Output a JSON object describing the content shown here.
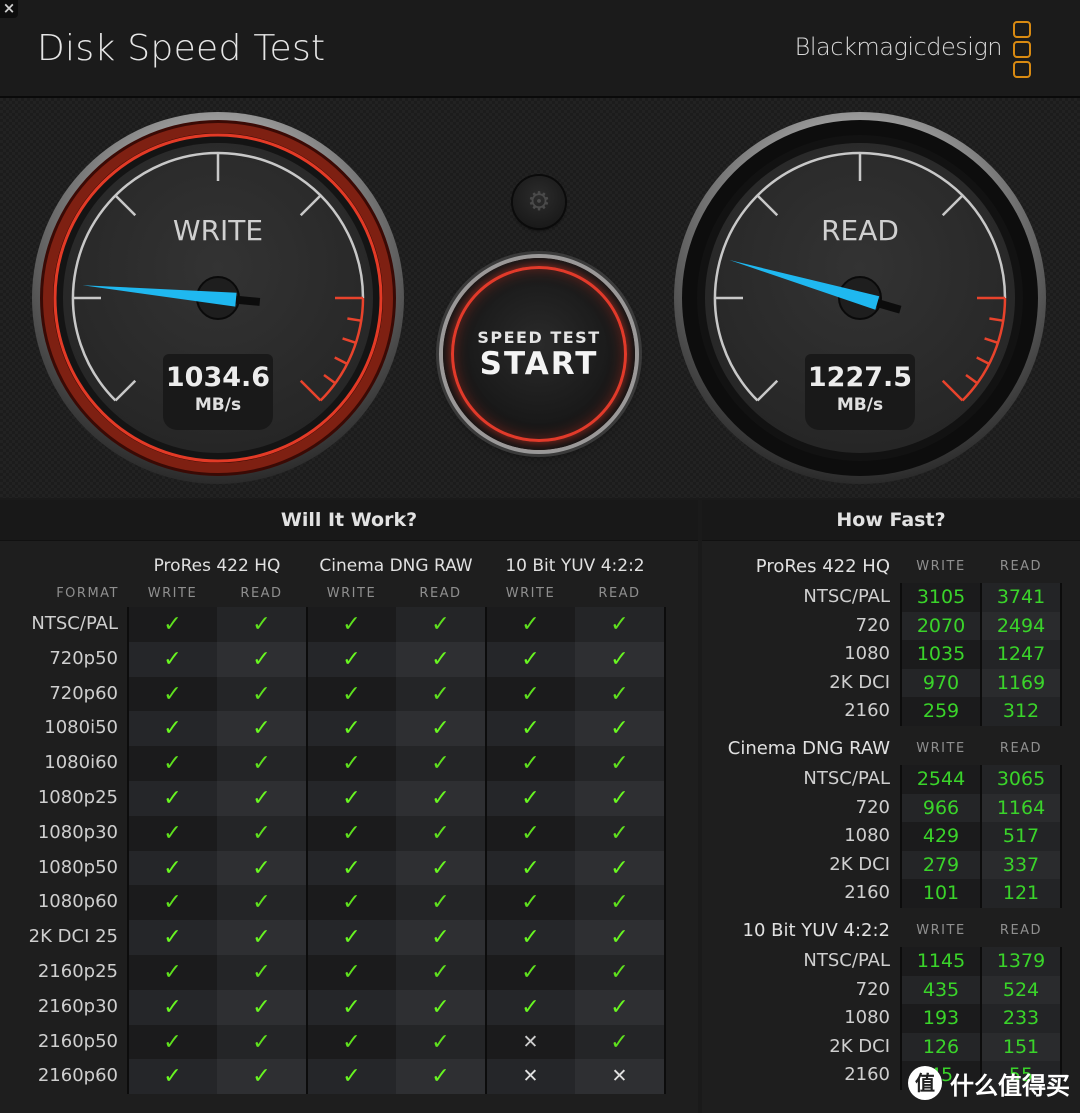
{
  "window": {
    "close_icon": "×",
    "title": "Disk Speed Test",
    "brand": "Blackmagicdesign"
  },
  "gauges": {
    "write": {
      "label": "WRITE",
      "value": "1034.6",
      "unit": "MB/s",
      "needle_fraction": 0.02
    },
    "read": {
      "label": "READ",
      "value": "1227.5",
      "unit": "MB/s",
      "needle_fraction": 0.06
    }
  },
  "controls": {
    "settings_icon": "⚙",
    "start_small": "SPEED TEST",
    "start_big": "START"
  },
  "will_it_work": {
    "title": "Will It Work?",
    "format_header": "FORMAT",
    "codecs": [
      "ProRes 422 HQ",
      "Cinema DNG RAW",
      "10 Bit YUV 4:2:2"
    ],
    "subheaders": [
      "WRITE",
      "READ",
      "WRITE",
      "READ",
      "WRITE",
      "READ"
    ],
    "rows": [
      {
        "format": "NTSC/PAL",
        "cells": [
          true,
          true,
          true,
          true,
          true,
          true
        ]
      },
      {
        "format": "720p50",
        "cells": [
          true,
          true,
          true,
          true,
          true,
          true
        ]
      },
      {
        "format": "720p60",
        "cells": [
          true,
          true,
          true,
          true,
          true,
          true
        ]
      },
      {
        "format": "1080i50",
        "cells": [
          true,
          true,
          true,
          true,
          true,
          true
        ]
      },
      {
        "format": "1080i60",
        "cells": [
          true,
          true,
          true,
          true,
          true,
          true
        ]
      },
      {
        "format": "1080p25",
        "cells": [
          true,
          true,
          true,
          true,
          true,
          true
        ]
      },
      {
        "format": "1080p30",
        "cells": [
          true,
          true,
          true,
          true,
          true,
          true
        ]
      },
      {
        "format": "1080p50",
        "cells": [
          true,
          true,
          true,
          true,
          true,
          true
        ]
      },
      {
        "format": "1080p60",
        "cells": [
          true,
          true,
          true,
          true,
          true,
          true
        ]
      },
      {
        "format": "2K DCI 25",
        "cells": [
          true,
          true,
          true,
          true,
          true,
          true
        ]
      },
      {
        "format": "2160p25",
        "cells": [
          true,
          true,
          true,
          true,
          true,
          true
        ]
      },
      {
        "format": "2160p30",
        "cells": [
          true,
          true,
          true,
          true,
          true,
          true
        ]
      },
      {
        "format": "2160p50",
        "cells": [
          true,
          true,
          true,
          true,
          false,
          true
        ]
      },
      {
        "format": "2160p60",
        "cells": [
          true,
          true,
          true,
          true,
          false,
          false
        ]
      }
    ],
    "check_glyph": "✓",
    "cross_glyph": "✕"
  },
  "how_fast": {
    "title": "How Fast?",
    "write_header": "WRITE",
    "read_header": "READ",
    "sections": [
      {
        "codec": "ProRes 422 HQ",
        "rows": [
          {
            "format": "NTSC/PAL",
            "write": "3105",
            "read": "3741"
          },
          {
            "format": "720",
            "write": "2070",
            "read": "2494"
          },
          {
            "format": "1080",
            "write": "1035",
            "read": "1247"
          },
          {
            "format": "2K DCI",
            "write": "970",
            "read": "1169"
          },
          {
            "format": "2160",
            "write": "259",
            "read": "312"
          }
        ]
      },
      {
        "codec": "Cinema DNG RAW",
        "rows": [
          {
            "format": "NTSC/PAL",
            "write": "2544",
            "read": "3065"
          },
          {
            "format": "720",
            "write": "966",
            "read": "1164"
          },
          {
            "format": "1080",
            "write": "429",
            "read": "517"
          },
          {
            "format": "2K DCI",
            "write": "279",
            "read": "337"
          },
          {
            "format": "2160",
            "write": "101",
            "read": "121"
          }
        ]
      },
      {
        "codec": "10 Bit YUV 4:2:2",
        "rows": [
          {
            "format": "NTSC/PAL",
            "write": "1145",
            "read": "1379"
          },
          {
            "format": "720",
            "write": "435",
            "read": "524"
          },
          {
            "format": "1080",
            "write": "193",
            "read": "233"
          },
          {
            "format": "2K DCI",
            "write": "126",
            "read": "151"
          },
          {
            "format": "2160",
            "write": "45",
            "read": "55"
          }
        ]
      }
    ]
  },
  "watermark": {
    "badge": "值",
    "text": "什么值得买"
  },
  "colors": {
    "accent_red": "#e23a2a",
    "needle_blue": "#1fb8f0",
    "check_green": "#5fe01e",
    "value_green": "#3ad42a",
    "brand_orange": "#d88a12"
  }
}
